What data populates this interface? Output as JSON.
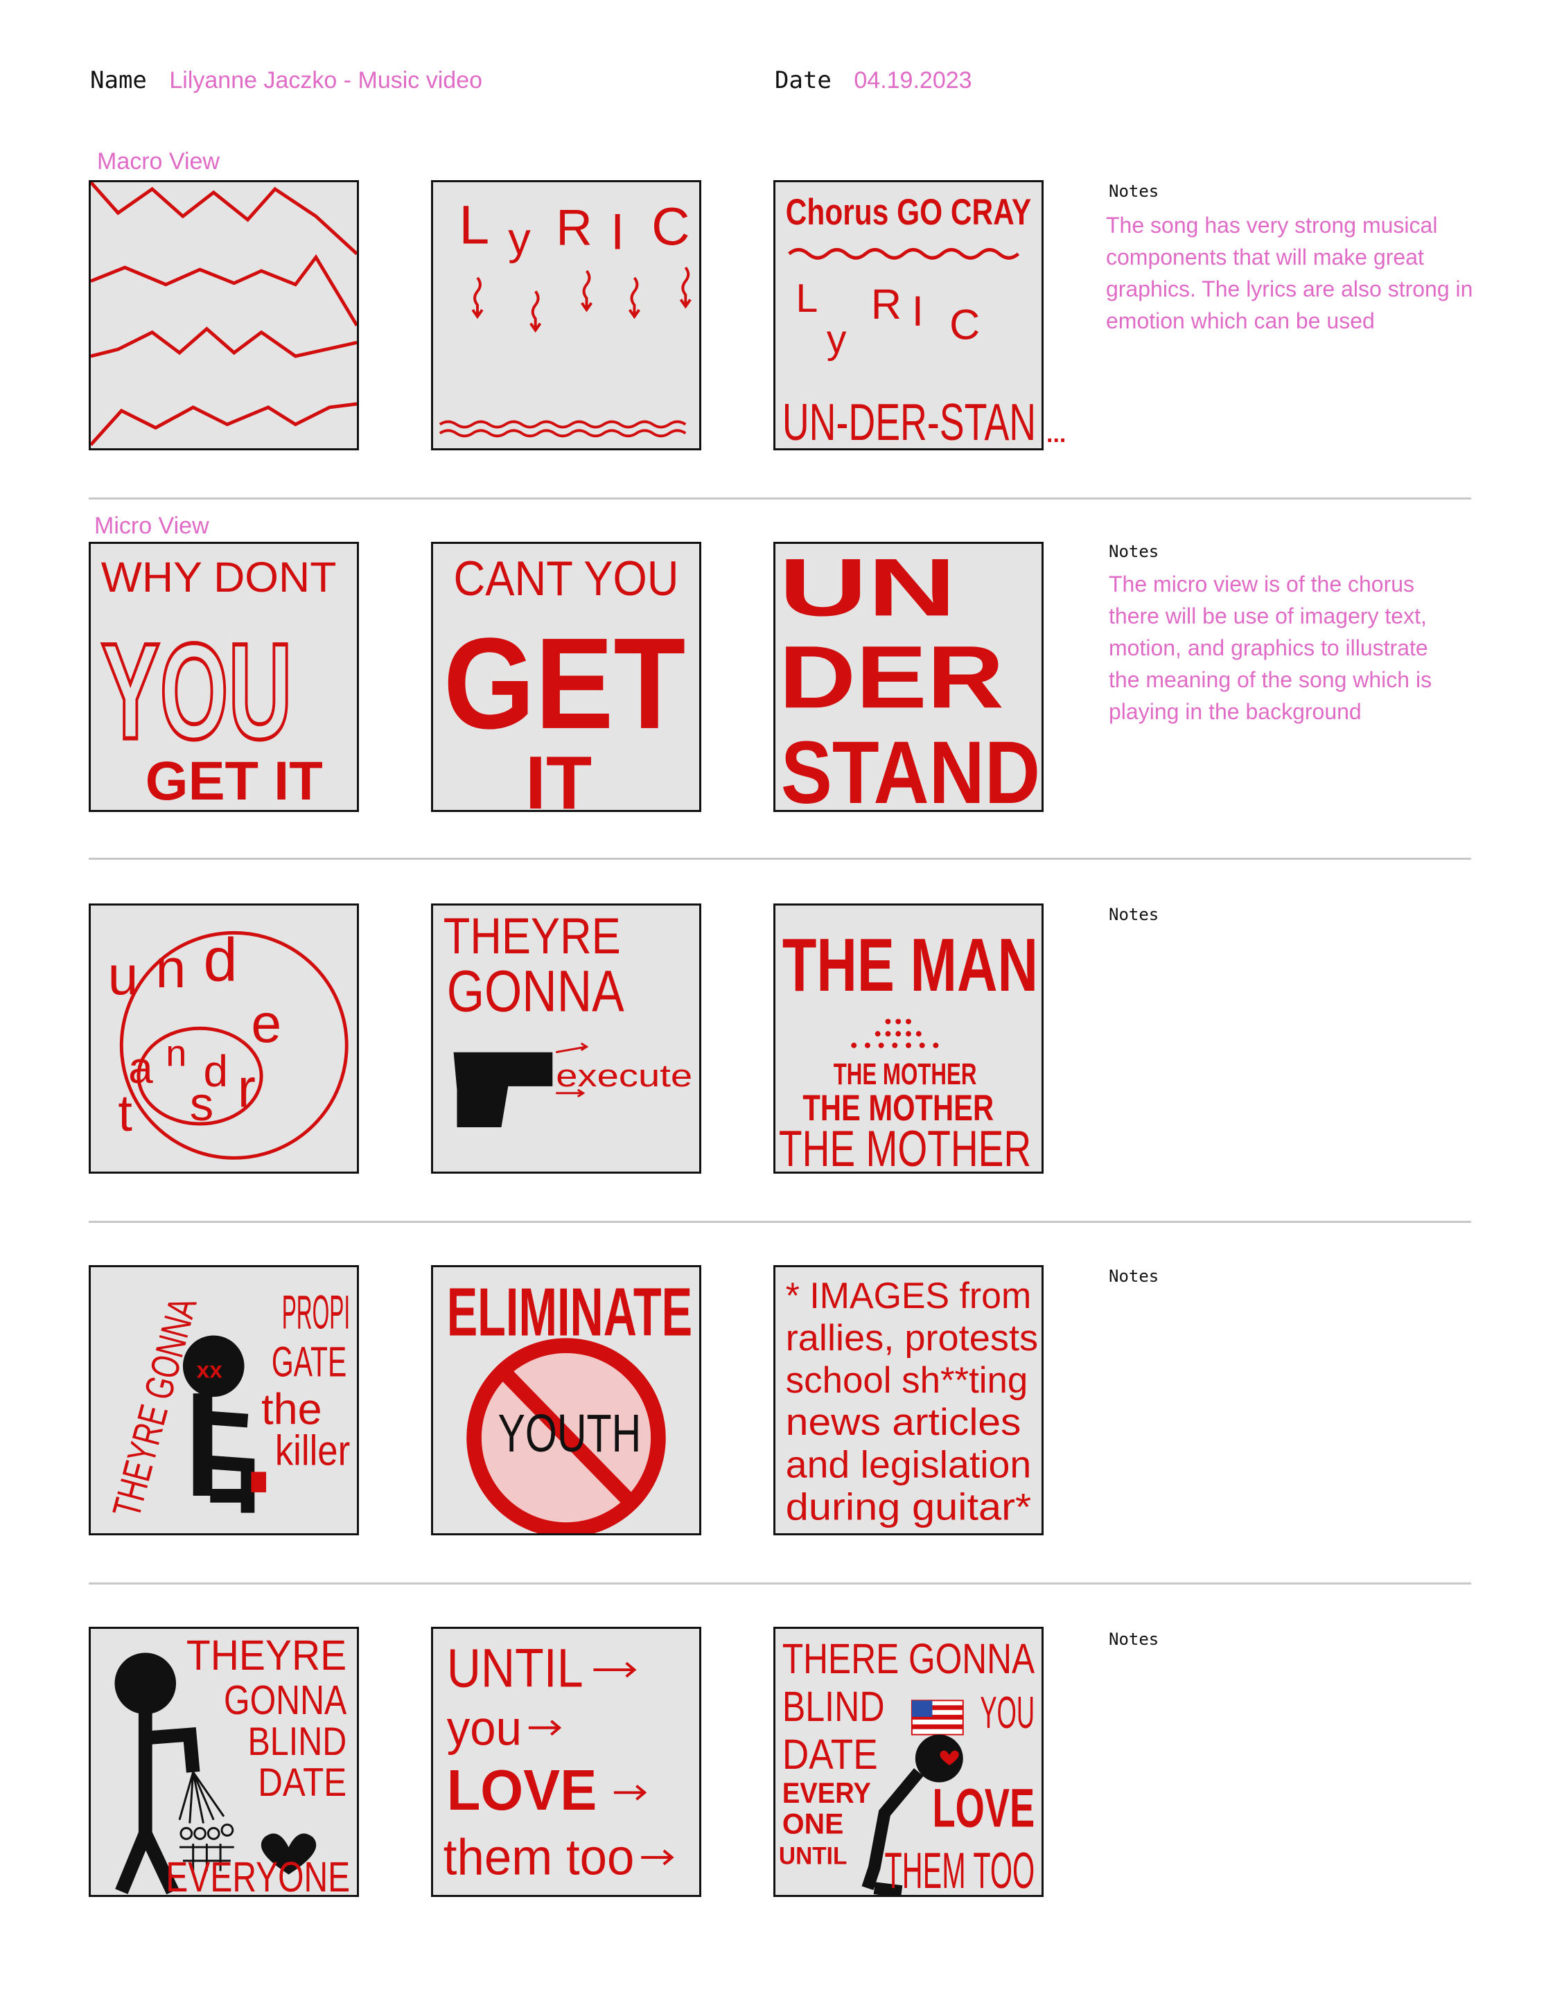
{
  "header": {
    "name_label": "Name",
    "name_value": "Lilyanne Jaczko - Music video",
    "date_label": "Date",
    "date_value": "04.19.2023"
  },
  "sections": {
    "macro_label": "Macro View",
    "micro_label": "Micro View"
  },
  "notes_label": "Notes",
  "rows": [
    {
      "notes": "The song has very strong musical components that will make great graphics. The lyrics are also strong in emotion which can be used",
      "panels": [
        {
          "texts": []
        },
        {
          "texts": [
            "L",
            "y",
            "R",
            "I",
            "C"
          ]
        },
        {
          "texts": [
            "Chorus GO CRAY",
            "L",
            "y",
            "R",
            "I",
            "C",
            "UN-DER-STAN",
            "..."
          ]
        }
      ]
    },
    {
      "notes": "The micro view is of the chorus there will be use of imagery text, motion, and graphics to illustrate the meaning of the song which is playing in the background",
      "panels": [
        {
          "texts": [
            "WHY DONT",
            "YOU",
            "GET IT"
          ]
        },
        {
          "texts": [
            "CANT YOU",
            "GET",
            "IT"
          ]
        },
        {
          "texts": [
            "UN",
            "DER",
            "STAND"
          ]
        }
      ]
    },
    {
      "notes": "",
      "panels": [
        {
          "texts": [
            "u",
            "n",
            "d",
            "e",
            "r",
            "s",
            "t",
            "a",
            "n",
            "d"
          ]
        },
        {
          "texts": [
            "THEYRE",
            "GONNA",
            "execute"
          ]
        },
        {
          "texts": [
            "THE MAN",
            "THE MOTHER",
            "THE MOTHER",
            "THE MOTHER"
          ]
        }
      ]
    },
    {
      "notes": "",
      "panels": [
        {
          "texts": [
            "THEYRE GONNA",
            "PROPI",
            "GATE",
            "the",
            "killer",
            "xx"
          ]
        },
        {
          "texts": [
            "ELIMINATE",
            "YOUTH"
          ]
        },
        {
          "texts": [
            "* IMAGES from",
            "rallies, protests",
            "school sh**ting",
            "news articles",
            "and legislation",
            "during guitar*"
          ]
        }
      ]
    },
    {
      "notes": "",
      "panels": [
        {
          "texts": [
            "THEYRE",
            "GONNA",
            "BLIND",
            "DATE",
            "EVERYONE"
          ]
        },
        {
          "texts": [
            "UNTIL",
            "you",
            "LOVE",
            "them too"
          ]
        },
        {
          "texts": [
            "THERE GONNA",
            "BLIND",
            "YOU",
            "DATE",
            "EVERY",
            "ONE",
            "UNTIL",
            "LOVE",
            "THEM TOO"
          ]
        }
      ]
    }
  ],
  "colors": {
    "ink_red": "#d10d0d",
    "pink": "#e06bc6",
    "panel_bg": "#e4e4e4"
  }
}
